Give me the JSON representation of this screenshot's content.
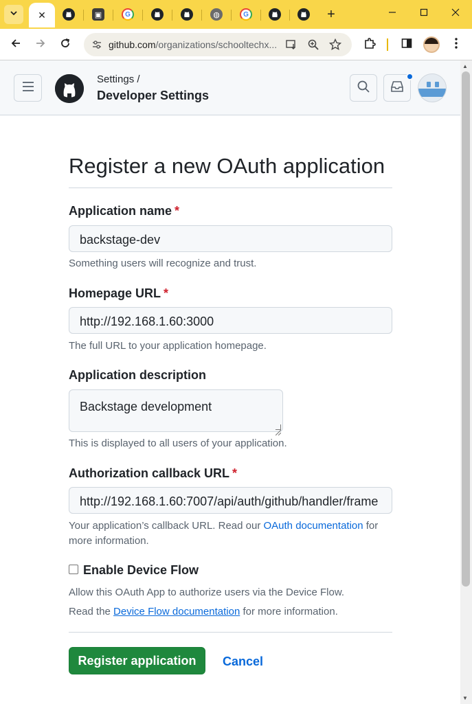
{
  "browser": {
    "tabs": [
      {
        "icon": "github-icon"
      },
      {
        "icon": "extension-icon"
      },
      {
        "icon": "google-icon"
      },
      {
        "icon": "github-icon"
      },
      {
        "icon": "github-icon"
      },
      {
        "icon": "globe-icon"
      },
      {
        "icon": "google-icon"
      },
      {
        "icon": "github-icon"
      },
      {
        "icon": "github-icon"
      }
    ],
    "close_glyph": "✕",
    "new_tab_glyph": "+",
    "url_host": "github.com",
    "url_path": "/organizations/schooltechx..."
  },
  "header": {
    "breadcrumb_parent": "Settings /",
    "breadcrumb_current": "Developer Settings"
  },
  "form": {
    "title": "Register a new OAuth application",
    "app_name": {
      "label": "Application name",
      "required_mark": "*",
      "value": "backstage-dev",
      "hint": "Something users will recognize and trust."
    },
    "homepage": {
      "label": "Homepage URL",
      "required_mark": "*",
      "value": "http://192.168.1.60:3000",
      "hint": "The full URL to your application homepage."
    },
    "description": {
      "label": "Application description",
      "value": "Backstage development",
      "hint": "This is displayed to all users of your application."
    },
    "callback": {
      "label": "Authorization callback URL",
      "required_mark": "*",
      "value": "http://192.168.1.60:7007/api/auth/github/handler/frame",
      "hint_before": "Your application’s callback URL. Read our ",
      "hint_link": "OAuth documentation",
      "hint_after": " for",
      "hint_line2": "more information."
    },
    "device_flow": {
      "label": "Enable Device Flow",
      "checked": false,
      "hint1": "Allow this OAuth App to authorize users via the Device Flow.",
      "hint2_before": "Read the ",
      "hint2_link": "Device Flow documentation",
      "hint2_after": " for more information."
    },
    "submit_label": "Register application",
    "cancel_label": "Cancel"
  },
  "colors": {
    "primary_button": "#1f883d",
    "link": "#0969da",
    "required": "#cf222e",
    "tab_strip": "#f9d649"
  }
}
